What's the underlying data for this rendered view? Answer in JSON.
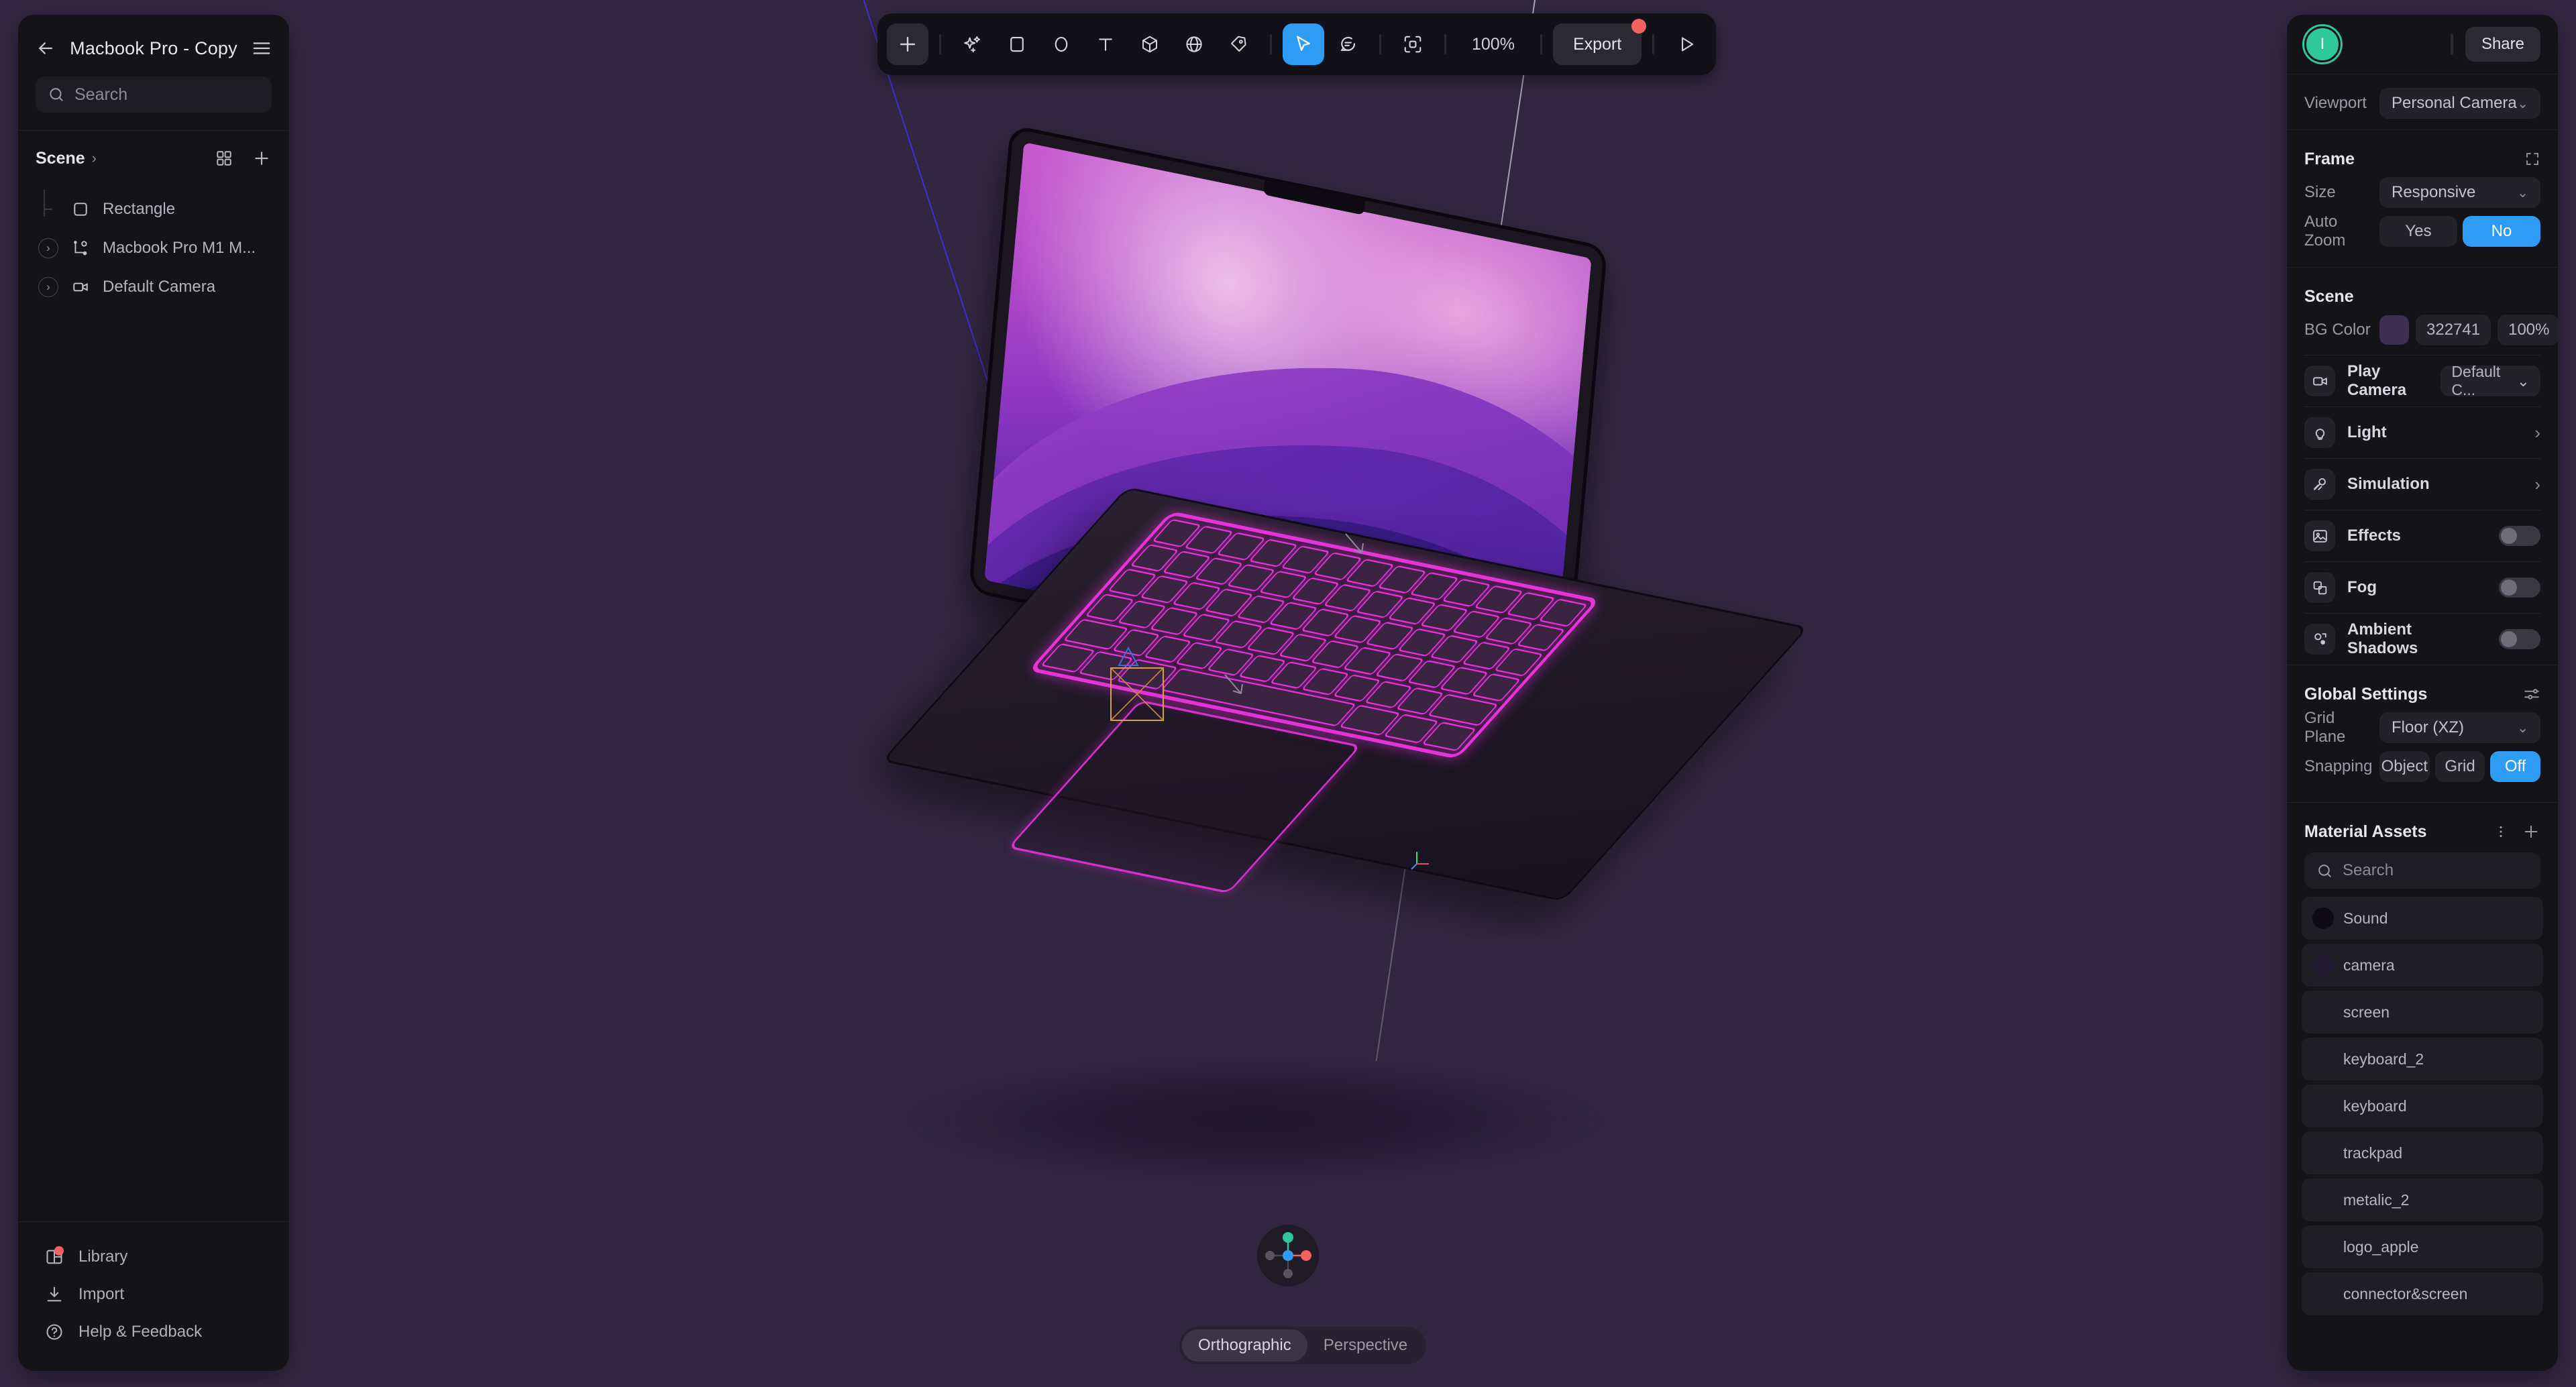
{
  "left_panel": {
    "back_icon": "arrow-left-icon",
    "title": "Macbook Pro - Copy",
    "menu_icon": "hamburger-menu-icon",
    "search": {
      "placeholder": "Search",
      "value": ""
    },
    "scene": {
      "label": "Scene",
      "chevron": "›",
      "grid_icon": "grid-view-icon",
      "add_icon": "plus-icon"
    },
    "tree": [
      {
        "label": "Rectangle",
        "icon": "square-icon",
        "expandable": false
      },
      {
        "label": "Macbook Pro M1 M...",
        "icon": "node-graph-icon",
        "expandable": true
      },
      {
        "label": "Default Camera",
        "icon": "camera-icon",
        "expandable": true
      }
    ],
    "footer": [
      {
        "label": "Library",
        "icon": "library-icon",
        "badge": true
      },
      {
        "label": "Import",
        "icon": "download-icon",
        "badge": false
      },
      {
        "label": "Help & Feedback",
        "icon": "question-circle-icon",
        "badge": false
      }
    ]
  },
  "toolbar": {
    "add_label": "+",
    "tools": [
      {
        "name": "magic-wand-icon"
      },
      {
        "name": "rectangle-icon"
      },
      {
        "name": "ellipse-icon"
      },
      {
        "name": "text-icon"
      },
      {
        "name": "cube-icon"
      },
      {
        "name": "sphere-icon"
      },
      {
        "name": "pen-icon"
      }
    ],
    "cursor_icon": "cursor-arrow-icon",
    "comment_icon": "comment-icon",
    "frame_icon": "frame-select-icon",
    "zoom_level": "100%",
    "export_label": "Export",
    "play_icon": "play-icon"
  },
  "canvas": {
    "camera_mode_options": [
      "Orthographic",
      "Perspective"
    ],
    "camera_mode_selected": "Orthographic",
    "gizmo": {
      "axis_y_color": "#2ec89b",
      "axis_x_color": "#f4615e",
      "center_color": "#2e9bf5",
      "axis_neg_color": "#5a5662"
    }
  },
  "right_panel": {
    "avatar_initial": "I",
    "share_label": "Share",
    "viewport": {
      "label": "Viewport",
      "value": "Personal Camera"
    },
    "frame": {
      "title": "Frame",
      "expand_icon": "expand-frame-icon",
      "size_label": "Size",
      "size_value": "Responsive",
      "auto_zoom_label": "Auto Zoom",
      "auto_zoom_options": [
        "Yes",
        "No"
      ],
      "auto_zoom_selected": "No"
    },
    "scene": {
      "title": "Scene",
      "bg_color_label": "BG Color",
      "bg_color_hex": "322741",
      "bg_color_swatch": "#3c2f4f",
      "bg_color_opacity": "100%"
    },
    "play_camera": {
      "label": "Play Camera",
      "value": "Default C...",
      "icon": "camera-icon"
    },
    "sections": [
      {
        "label": "Light",
        "icon": "lightbulb-icon",
        "control": "chevron"
      },
      {
        "label": "Simulation",
        "icon": "simulation-icon",
        "control": "chevron"
      },
      {
        "label": "Effects",
        "icon": "image-icon",
        "control": "toggle",
        "enabled": false
      },
      {
        "label": "Fog",
        "icon": "layers-icon",
        "control": "toggle",
        "enabled": false
      },
      {
        "label": "Ambient Shadows",
        "icon": "ambient-shadow-icon",
        "control": "toggle",
        "enabled": false
      }
    ],
    "global_settings": {
      "title": "Global Settings",
      "settings_icon": "sliders-icon",
      "grid_plane_label": "Grid Plane",
      "grid_plane_value": "Floor (XZ)",
      "snapping_label": "Snapping",
      "snapping_options": [
        "Object",
        "Grid",
        "Off"
      ],
      "snapping_selected": "Off"
    },
    "material_assets": {
      "title": "Material Assets",
      "more_icon": "kebab-menu-icon",
      "add_icon": "plus-icon",
      "search_placeholder": "Search",
      "items": [
        {
          "name": "Sound",
          "swatch": "#0d0b11"
        },
        {
          "name": "camera",
          "swatch": "#231a33"
        },
        {
          "name": "screen",
          "swatch": ""
        },
        {
          "name": "keyboard_2",
          "swatch": ""
        },
        {
          "name": "keyboard",
          "swatch": ""
        },
        {
          "name": "trackpad",
          "swatch": ""
        },
        {
          "name": "metalic_2",
          "swatch": ""
        },
        {
          "name": "logo_apple",
          "swatch": ""
        },
        {
          "name": "connector&screen",
          "swatch": ""
        }
      ]
    }
  },
  "colors": {
    "canvas_bg": "#322741",
    "panel_bg": "#141318",
    "accent_blue": "#2e9bf5",
    "accent_green": "#2ec89b",
    "accent_red": "#f4615e",
    "keyboard_glow": "#e534d9"
  }
}
